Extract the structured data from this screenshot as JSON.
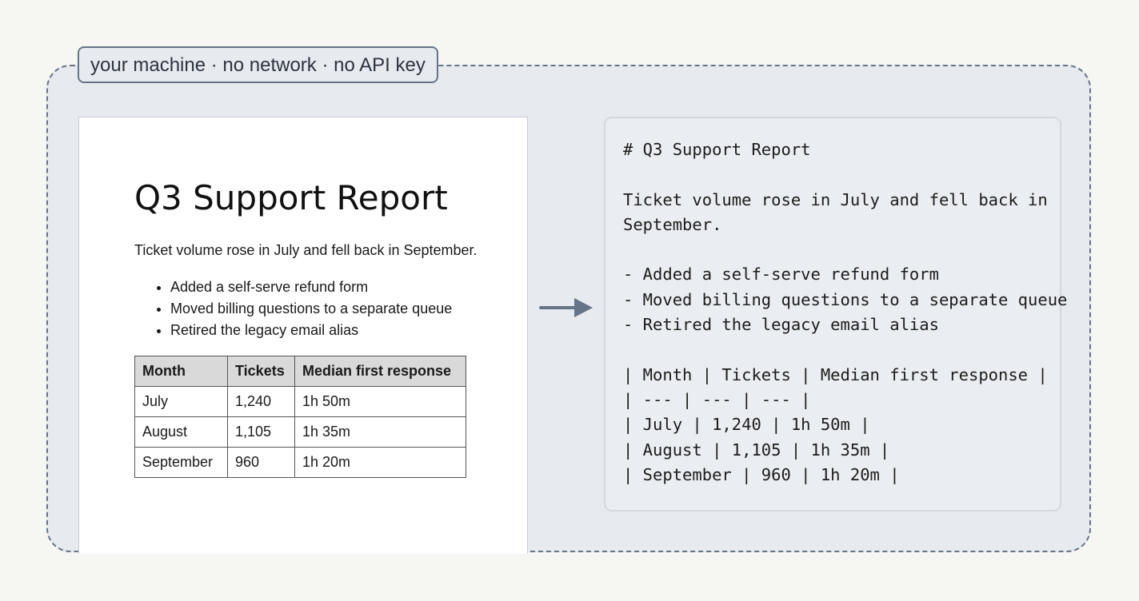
{
  "boundary": {
    "label": "your machine · no network · no API key"
  },
  "document": {
    "title": "Q3 Support Report",
    "intro": "Ticket volume rose in July and fell back in September.",
    "bullets": [
      "Added a self-serve refund form",
      "Moved billing questions to a separate queue",
      "Retired the legacy email alias"
    ],
    "table": {
      "headers": [
        "Month",
        "Tickets",
        "Median first response"
      ],
      "rows": [
        [
          "July",
          "1,240",
          "1h 50m"
        ],
        [
          "August",
          "1,105",
          "1h 35m"
        ],
        [
          "September",
          "960",
          "1h 20m"
        ]
      ]
    }
  },
  "arrow": {
    "icon": "right-arrow-icon",
    "color": "#667488"
  },
  "markdown": {
    "lines": [
      "# Q3 Support Report",
      "",
      "Ticket volume rose in July and fell back in",
      "September.",
      "",
      "- Added a self-serve refund form",
      "- Moved billing questions to a separate queue",
      "- Retired the legacy email alias",
      "",
      "| Month | Tickets | Median first response |",
      "| --- | --- | --- |",
      "| July | 1,240 | 1h 50m |",
      "| August | 1,105 | 1h 35m |",
      "| September | 960 | 1h 20m |"
    ]
  }
}
